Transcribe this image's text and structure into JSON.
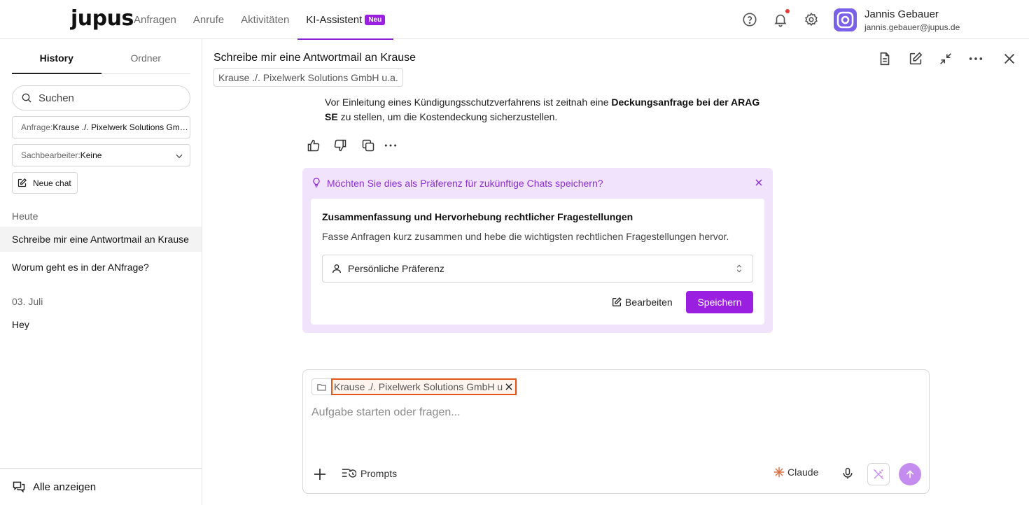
{
  "app": {
    "logo": "jupus"
  },
  "nav": {
    "items": [
      {
        "label": "Anfragen"
      },
      {
        "label": "Anrufe"
      },
      {
        "label": "Aktivitäten"
      },
      {
        "label": "KI-Assistent",
        "badge": "Neu"
      }
    ]
  },
  "user": {
    "name": "Jannis Gebauer",
    "email": "jannis.gebauer@jupus.de"
  },
  "sidebar": {
    "tabs": [
      {
        "label": "History"
      },
      {
        "label": "Ordner"
      }
    ],
    "search_placeholder": "Suchen",
    "filters": {
      "anfrage_key": "Anfrage:",
      "anfrage_value": "Krause ./. Pixelwerk Solutions GmbH u.a.",
      "sachbearbeiter_key": "Sachbearbeiter:",
      "sachbearbeiter_value": "Keine"
    },
    "new_chat": "Neue chat",
    "sections": [
      {
        "title": "Heute",
        "items": [
          "Schreibe mir eine Antwortmail an Krause",
          "Worum geht es in der ANfrage?"
        ]
      },
      {
        "title": "03. Juli",
        "items": [
          "Hey"
        ]
      }
    ],
    "footer": "Alle anzeigen"
  },
  "chat": {
    "title": "Schreibe mir eine Antwortmail an Krause",
    "case": "Krause ./. Pixelwerk Solutions GmbH u.a.",
    "message": {
      "part1": "Vor Einleitung eines Kündigungsschutzverfahrens ist zeitnah eine ",
      "bold": "Deckungsanfrage bei der ARAG SE",
      "part2": " zu stellen, um die Kostendeckung sicherzustellen."
    }
  },
  "preference": {
    "question": "Möchten Sie dies als Präferenz für zukünftige Chats speichern?",
    "heading": "Zusammenfassung und Hervorhebung rechtlicher Fragestellungen",
    "description": "Fasse Anfragen kurz zusammen und hebe die wichtigsten rechtlichen Fragestellungen hervor.",
    "scope": "Persönliche Präferenz",
    "edit_label": "Bearbeiten",
    "save_label": "Speichern"
  },
  "composer": {
    "context_chip": "Krause ./. Pixelwerk Solutions GmbH u",
    "placeholder": "Aufgabe starten oder fragen...",
    "prompts_label": "Prompts",
    "model_label": "Claude"
  },
  "colors": {
    "accent": "#9b1fe0",
    "pref_bg": "#f1e3fb",
    "highlight": "#e3561b"
  }
}
